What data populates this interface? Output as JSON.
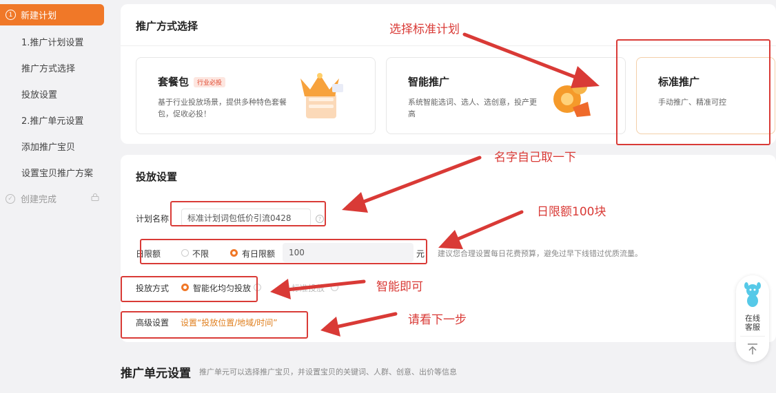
{
  "sidebar": {
    "active_num": "1",
    "active_label": "新建计划",
    "items": [
      "1.推广计划设置",
      "推广方式选择",
      "投放设置",
      "2.推广单元设置",
      "添加推广宝贝",
      "设置宝贝推广方案"
    ],
    "done_label": "创建完成"
  },
  "promo_select": {
    "title": "推广方式选择",
    "options": [
      {
        "title": "套餐包",
        "badge": "行业必投",
        "desc": "基于行业投放场景，提供多种特色套餐包，促收必投！"
      },
      {
        "title": "智能推广",
        "desc": "系统智能选词、选人、选创意，投产更高"
      },
      {
        "title": "标准推广",
        "desc": "手动推广、精准可控"
      }
    ]
  },
  "delivery": {
    "title": "投放设置",
    "plan_name_label": "计划名称",
    "plan_name_value": "标准计划词包低价引流0428",
    "daily_limit_label": "日限额",
    "daily_opt_unlimited": "不限",
    "daily_opt_limited": "有日限额",
    "daily_value": "100",
    "currency_unit": "元",
    "daily_hint": "建议您合理设置每日花费预算，避免过早下线错过优质流量。",
    "method_label": "投放方式",
    "method_opt_smart": "智能化均匀投放",
    "method_opt_other": "标准投放",
    "advanced_label": "高级设置",
    "advanced_link": "设置“投放位置/地域/时间”"
  },
  "unit": {
    "title": "推广单元设置",
    "desc": "推广单元可以选择推广宝贝，并设置宝贝的关键词、人群、创意、出价等信息"
  },
  "floating": {
    "service_line1": "在线",
    "service_line2": "客服"
  },
  "annotations": {
    "select_standard": "选择标准计划",
    "name_yourself": "名字自己取一下",
    "daily_100": "日限额100块",
    "smart_ok": "智能即可",
    "see_next": "请看下一步"
  },
  "colors": {
    "accent": "#f07828",
    "annotation_red": "#d93a36",
    "link_orange": "#e08020"
  }
}
